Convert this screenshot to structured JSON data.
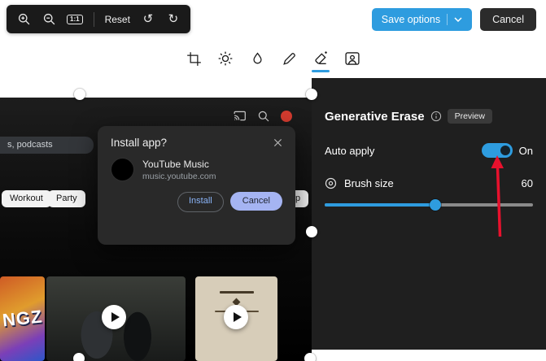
{
  "header": {
    "toolbar": {
      "actual_size_label": "1:1",
      "reset_label": "Reset"
    },
    "save_options_label": "Save options",
    "cancel_label": "Cancel"
  },
  "icons": {
    "undo": "↺",
    "redo": "↻"
  },
  "tools": {
    "items": [
      "crop",
      "adjustment",
      "filter",
      "markup",
      "erase",
      "background"
    ],
    "selected": "erase"
  },
  "panel": {
    "title": "Generative Erase",
    "preview_badge": "Preview",
    "auto_apply_label": "Auto apply",
    "auto_apply_state": "On",
    "brush_size_label": "Brush size",
    "brush_size_value": 60,
    "accent_color": "#2e9cdf"
  },
  "photo": {
    "search_text": "s, podcasts",
    "chips": [
      "Workout",
      "Party",
      "Sleep"
    ],
    "install_dialog": {
      "title": "Install app?",
      "app_name": "YouTube Music",
      "app_url": "music.youtube.com",
      "install_label": "Install",
      "cancel_label": "Cancel"
    },
    "thumbnail_text": "NGZ"
  }
}
